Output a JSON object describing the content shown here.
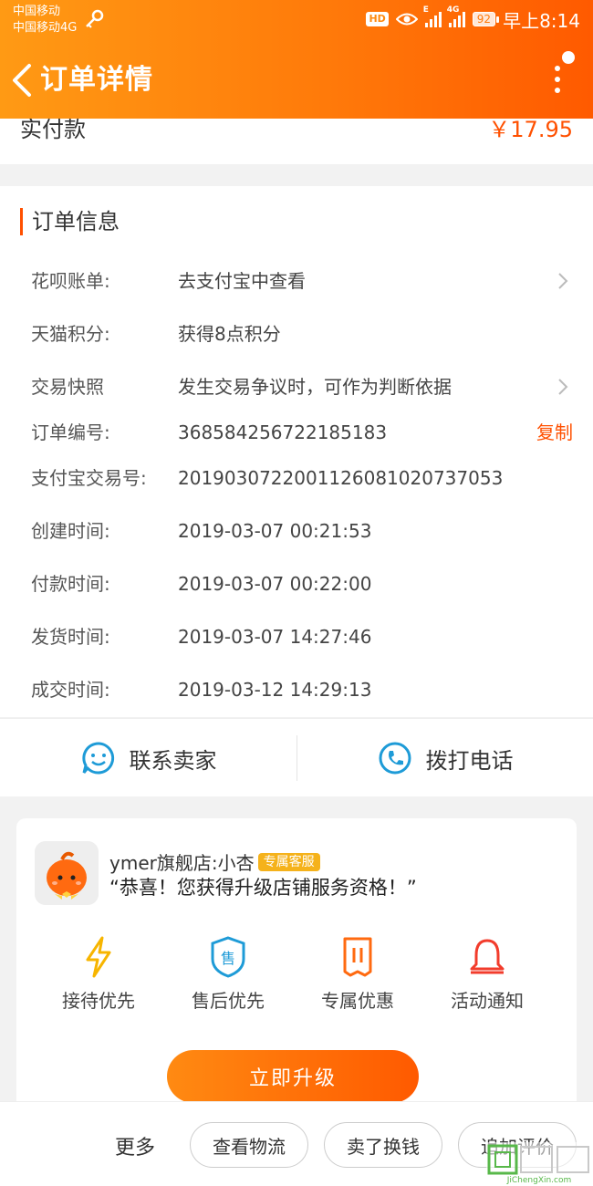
{
  "status_bar": {
    "carrier1": "中国移动",
    "carrier2": "中国移动4G",
    "hd": "HD",
    "net1": "E",
    "net2": "4G",
    "battery": "92",
    "time": "早上8:14"
  },
  "header": {
    "title": "订单详情",
    "back_icon": "chevron-left-icon",
    "more_icon": "more-vertical-icon",
    "color_from": "#ff9a14",
    "color_to": "#ff5a00"
  },
  "paid": {
    "label": "实付款",
    "value": "￥17.95"
  },
  "order_info": {
    "title": "订单信息",
    "rows": [
      {
        "key": "花呗账单:",
        "value": "去支付宝中查看"
      },
      {
        "key": "天猫积分:",
        "value": "获得8点积分"
      },
      {
        "key": "交易快照",
        "value": "发生交易争议时，可作为判断依据"
      },
      {
        "key": "订单编号:",
        "value": "368584256722185183"
      },
      {
        "key": "支付宝交易号:",
        "value": "2019030722001126081020737053"
      },
      {
        "key": "创建时间:",
        "value": "2019-03-07 00:21:53"
      },
      {
        "key": "付款时间:",
        "value": "2019-03-07 00:22:00"
      },
      {
        "key": "发货时间:",
        "value": "2019-03-07 14:27:46"
      },
      {
        "key": "成交时间:",
        "value": "2019-03-12 14:29:13"
      }
    ],
    "copy_label": "复制"
  },
  "contact": {
    "seller_label": "联系卖家",
    "seller_icon": "chat-smile-icon",
    "phone_label": "拨打电话",
    "phone_icon": "phone-icon"
  },
  "service": {
    "name": "ymer旗舰店:小杏",
    "badge": "专属客服",
    "message": "“恭喜！您获得升级店铺服务资格！”",
    "perks": [
      {
        "label": "接待优先",
        "icon": "lightning-icon"
      },
      {
        "label": "售后优先",
        "icon": "shield-sale-icon"
      },
      {
        "label": "专属优惠",
        "icon": "ticket-icon"
      },
      {
        "label": "活动通知",
        "icon": "bell-icon"
      }
    ],
    "upgrade_label": "立即升级"
  },
  "bottom_bar": {
    "more_label": "更多",
    "buttons": [
      "查看物流",
      "卖了换钱",
      "追加评价"
    ]
  },
  "watermark": {
    "text": "JiChengXin.com"
  },
  "colors": {
    "accent": "#ff5000",
    "orange": "#ff7a0a",
    "blue": "#1e9bd7",
    "badge": "#f5b21b"
  }
}
